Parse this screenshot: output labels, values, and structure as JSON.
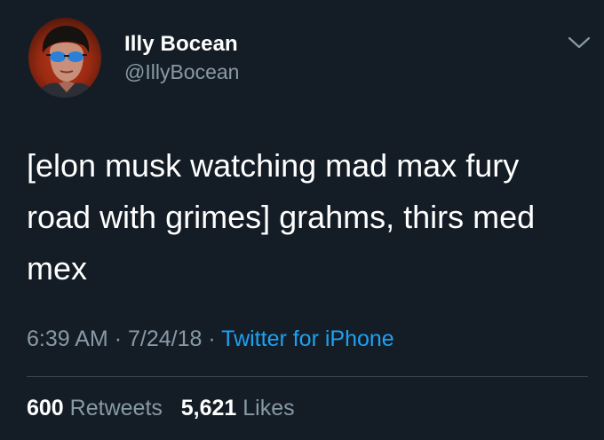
{
  "tweet": {
    "author": {
      "display_name": "Illy Bocean",
      "handle": "@IllyBocean"
    },
    "text_lines": [
      "[elon musk watching mad max fury",
      "road with grimes] grahms, thirs med",
      "mex"
    ],
    "time": "6:39 AM",
    "date": "7/24/18",
    "separator": "·",
    "source": "Twitter for iPhone",
    "retweets": {
      "count": "600",
      "label": "Retweets"
    },
    "likes": {
      "count": "5,621",
      "label": "Likes"
    }
  },
  "icons": {
    "menu": "chevron-down-icon"
  },
  "colors": {
    "background": "#141d26",
    "primary_text": "#ffffff",
    "secondary_text": "#8899a6",
    "link": "#1da1f2",
    "divider": "#38444d"
  }
}
